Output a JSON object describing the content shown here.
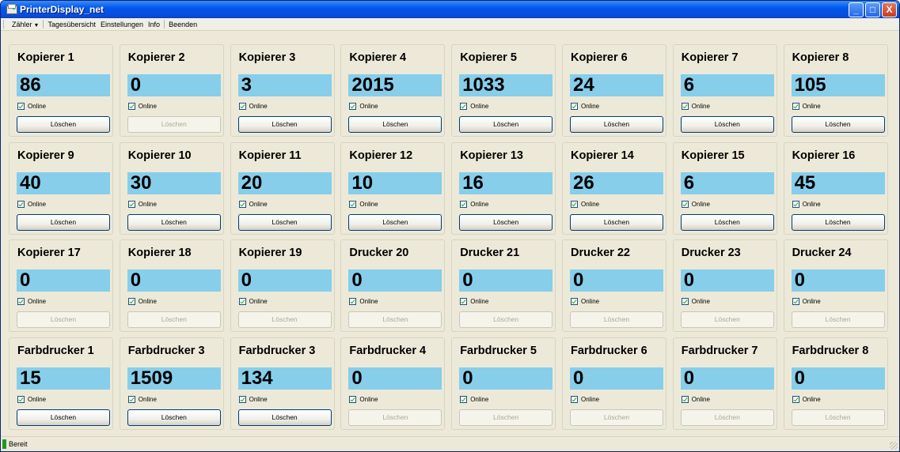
{
  "window": {
    "title": "PrinterDisplay_net",
    "min": "_",
    "max": "□",
    "close": "X"
  },
  "menu": {
    "items": [
      "Zähler",
      "Tagesübersicht",
      "Einstellungen",
      "Info",
      "Beenden"
    ],
    "has_dropdown_index": 0
  },
  "tiles": [
    {
      "name": "Kopierer 1",
      "count": "86",
      "online": "Online",
      "button": "Löschen",
      "enabled": true
    },
    {
      "name": "Kopierer 2",
      "count": "0",
      "online": "Online",
      "button": "Löschen",
      "enabled": false
    },
    {
      "name": "Kopierer 3",
      "count": "3",
      "online": "Online",
      "button": "Löschen",
      "enabled": true
    },
    {
      "name": "Kopierer 4",
      "count": "2015",
      "online": "Online",
      "button": "Löschen",
      "enabled": true
    },
    {
      "name": "Kopierer 5",
      "count": "1033",
      "online": "Online",
      "button": "Löschen",
      "enabled": true
    },
    {
      "name": "Kopierer 6",
      "count": "24",
      "online": "Online",
      "button": "Löschen",
      "enabled": true
    },
    {
      "name": "Kopierer 7",
      "count": "6",
      "online": "Online",
      "button": "Löschen",
      "enabled": true
    },
    {
      "name": "Kopierer 8",
      "count": "105",
      "online": "Online",
      "button": "Löschen",
      "enabled": true
    },
    {
      "name": "Kopierer 9",
      "count": "40",
      "online": "Online",
      "button": "Löschen",
      "enabled": true
    },
    {
      "name": "Kopierer 10",
      "count": "30",
      "online": "Online",
      "button": "Löschen",
      "enabled": true
    },
    {
      "name": "Kopierer 11",
      "count": "20",
      "online": "Online",
      "button": "Löschen",
      "enabled": true
    },
    {
      "name": "Kopierer 12",
      "count": "10",
      "online": "Online",
      "button": "Löschen",
      "enabled": true
    },
    {
      "name": "Kopierer 13",
      "count": "16",
      "online": "Online",
      "button": "Löschen",
      "enabled": true
    },
    {
      "name": "Kopierer 14",
      "count": "26",
      "online": "Online",
      "button": "Löschen",
      "enabled": true
    },
    {
      "name": "Kopierer 15",
      "count": "6",
      "online": "Online",
      "button": "Löschen",
      "enabled": true
    },
    {
      "name": "Kopierer 16",
      "count": "45",
      "online": "Online",
      "button": "Löschen",
      "enabled": true
    },
    {
      "name": "Kopierer 17",
      "count": "0",
      "online": "Online",
      "button": "Löschen",
      "enabled": false
    },
    {
      "name": "Kopierer 18",
      "count": "0",
      "online": "Online",
      "button": "Löschen",
      "enabled": false
    },
    {
      "name": "Kopierer 19",
      "count": "0",
      "online": "Online",
      "button": "Löschen",
      "enabled": false
    },
    {
      "name": "Drucker 20",
      "count": "0",
      "online": "Online",
      "button": "Löschen",
      "enabled": false
    },
    {
      "name": "Drucker 21",
      "count": "0",
      "online": "Online",
      "button": "Löschen",
      "enabled": false
    },
    {
      "name": "Drucker 22",
      "count": "0",
      "online": "Online",
      "button": "Löschen",
      "enabled": false
    },
    {
      "name": "Drucker 23",
      "count": "0",
      "online": "Online",
      "button": "Löschen",
      "enabled": false
    },
    {
      "name": "Drucker 24",
      "count": "0",
      "online": "Online",
      "button": "Löschen",
      "enabled": false
    },
    {
      "name": "Farbdrucker 1",
      "count": "15",
      "online": "Online",
      "button": "Löschen",
      "enabled": true
    },
    {
      "name": "Farbdrucker 3",
      "count": "1509",
      "online": "Online",
      "button": "Löschen",
      "enabled": true
    },
    {
      "name": "Farbdrucker 3",
      "count": "134",
      "online": "Online",
      "button": "Löschen",
      "enabled": true
    },
    {
      "name": "Farbdrucker 4",
      "count": "0",
      "online": "Online",
      "button": "Löschen",
      "enabled": false
    },
    {
      "name": "Farbdrucker 5",
      "count": "0",
      "online": "Online",
      "button": "Löschen",
      "enabled": false
    },
    {
      "name": "Farbdrucker 6",
      "count": "0",
      "online": "Online",
      "button": "Löschen",
      "enabled": false
    },
    {
      "name": "Farbdrucker 7",
      "count": "0",
      "online": "Online",
      "button": "Löschen",
      "enabled": false
    },
    {
      "name": "Farbdrucker 8",
      "count": "0",
      "online": "Online",
      "button": "Löschen",
      "enabled": false
    }
  ],
  "status": {
    "text": "Bereit"
  },
  "colors": {
    "counter_bg": "#87ceeb",
    "titlebar": "#0058ee",
    "status_indicator": "#1e9a1e"
  }
}
